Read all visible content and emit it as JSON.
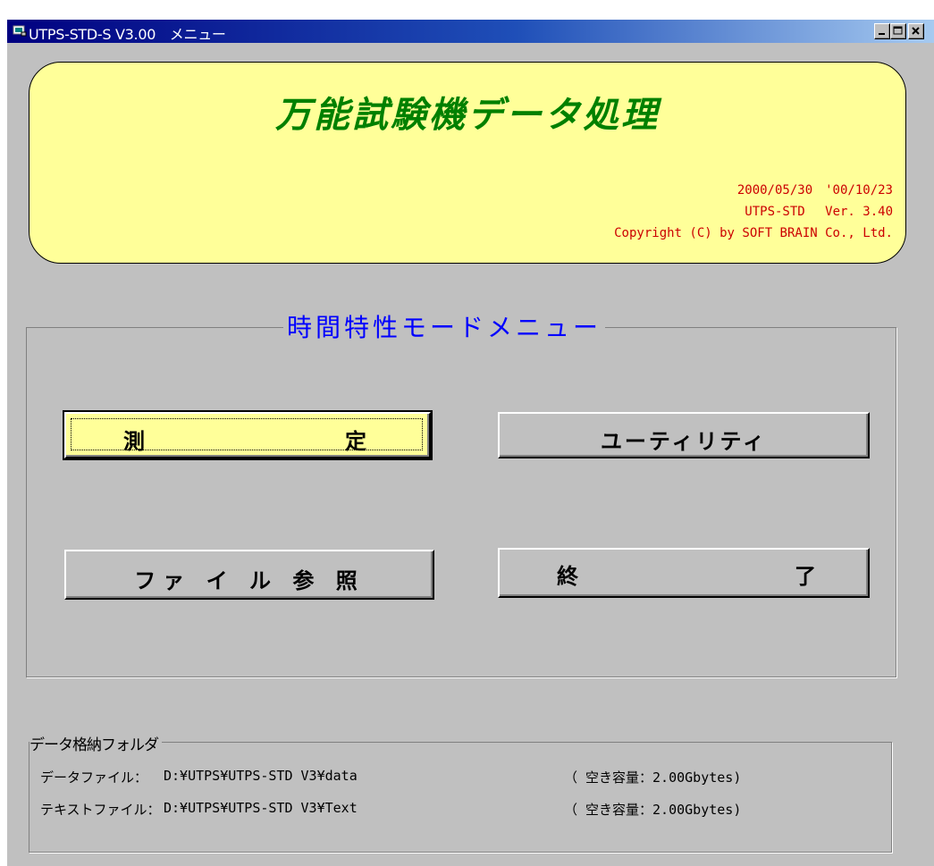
{
  "window": {
    "title": "UTPS-STD-S V3.00　メニュー",
    "controls": [
      "minimize-icon",
      "maximize-icon",
      "close-icon"
    ]
  },
  "banner": {
    "title": "万能試験機データ処理",
    "date_line": "2000/05/30　'00/10/23",
    "version_line": "UTPS-STD　 Ver. 3.40",
    "copyright_line": "Copyright (C) by SOFT BRAIN Co., Ltd."
  },
  "menu": {
    "group_title": "時間特性モードメニュー",
    "buttons": [
      {
        "left": "測",
        "right": "定"
      },
      {
        "label": "ユーティリティ"
      },
      {
        "label": "ファ イ ル 参 照"
      },
      {
        "left": "終",
        "right": "了"
      }
    ]
  },
  "folders": {
    "group_title": "データ格納フォルダ",
    "rows": [
      {
        "label": "データファイル：",
        "path": "D:¥UTPS¥UTPS-STD V3¥data",
        "space": "（ 空き容量：2.00Gbytes)"
      },
      {
        "label": "テキストファイル：",
        "path": "D:¥UTPS¥UTPS-STD V3¥Text",
        "space": "（ 空き容量：2.00Gbytes)"
      }
    ]
  },
  "colors": {
    "titlebar": "#000080",
    "banner_bg": "#ffff99",
    "banner_title": "#008000",
    "banner_info": "#cc0000",
    "group_title": "#0000ff",
    "window_bg": "#c0c0c0"
  }
}
